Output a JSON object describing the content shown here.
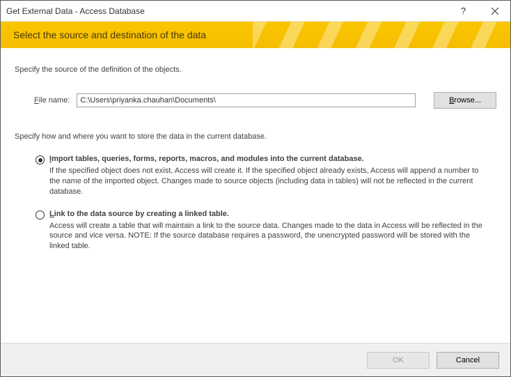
{
  "titlebar": {
    "title": "Get External Data - Access Database",
    "help": "?",
    "close": "✕"
  },
  "header": {
    "title": "Select the source and destination of the data"
  },
  "source": {
    "prompt": "Specify the source of the definition of the objects.",
    "file_label_prefix": "F",
    "file_label_rest": "ile name:",
    "file_value": "C:\\Users\\priyanka.chauhan\\Documents\\",
    "browse_prefix": "B",
    "browse_rest": "rowse..."
  },
  "store": {
    "prompt": "Specify how and where you want to store the data in the current database.",
    "option1": {
      "selected": true,
      "title_prefix": "I",
      "title_rest": "mport tables, queries, forms, reports, macros, and modules into the current database.",
      "desc": "If the specified object does not exist, Access will create it. If the specified object already exists, Access will append a number to the name of the imported object. Changes made to source objects (including data in tables) will not be reflected in the current database."
    },
    "option2": {
      "selected": false,
      "title_prefix": "L",
      "title_rest": "ink to the data source by creating a linked table.",
      "desc": "Access will create a table that will maintain a link to the source data. Changes made to the data in Access will be reflected in the source and vice versa. NOTE:  If the source database requires a password, the unencrypted password will be stored with the linked table."
    }
  },
  "footer": {
    "ok": "OK",
    "cancel": "Cancel"
  }
}
